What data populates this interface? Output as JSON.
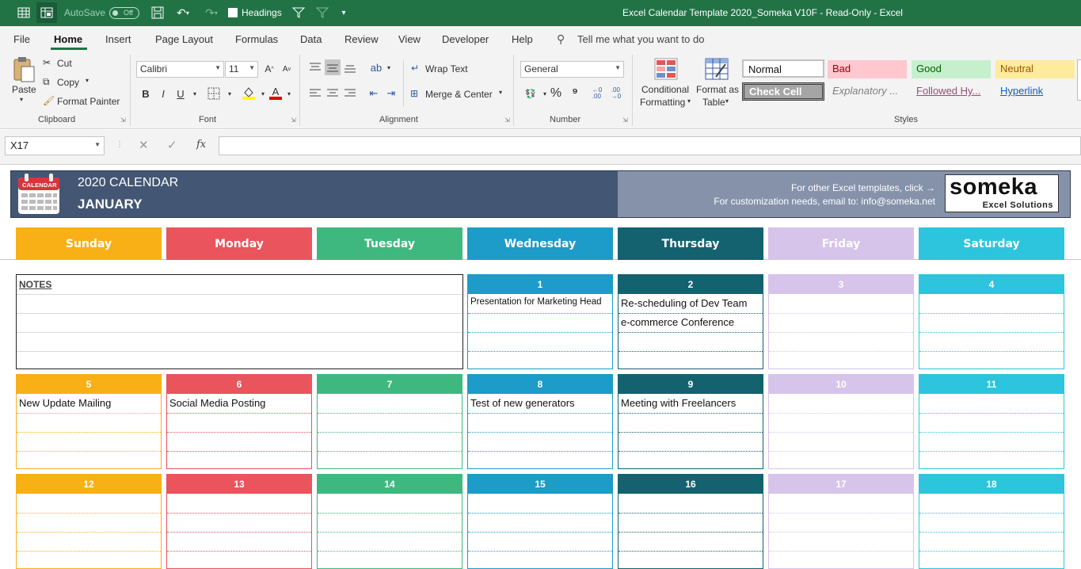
{
  "titlebar": {
    "autosave_label": "AutoSave",
    "autosave_state": "Off",
    "headings_label": "Headings",
    "window_title": "Excel Calendar Template 2020_Someka V10F  -  Read-Only  -  Excel"
  },
  "menu": [
    "File",
    "Home",
    "Insert",
    "Page Layout",
    "Formulas",
    "Data",
    "Review",
    "View",
    "Developer",
    "Help"
  ],
  "tell_me": "Tell me what you want to do",
  "ribbon": {
    "clipboard": {
      "paste": "Paste",
      "cut": "Cut",
      "copy": "Copy",
      "format_painter": "Format Painter",
      "group": "Clipboard"
    },
    "font": {
      "name": "Calibri",
      "size": "11",
      "group": "Font"
    },
    "alignment": {
      "wrap": "Wrap Text",
      "merge": "Merge & Center",
      "group": "Alignment"
    },
    "number": {
      "format": "General",
      "group": "Number"
    },
    "styles": {
      "conditional_1": "Conditional",
      "conditional_2": "Formatting",
      "format_table_1": "Format as",
      "format_table_2": "Table",
      "normal": "Normal",
      "bad": "Bad",
      "good": "Good",
      "neutral": "Neutral",
      "check_cell": "Check Cell",
      "explanatory": "Explanatory ...",
      "followed": "Followed Hy...",
      "hyperlink": "Hyperlink",
      "group": "Styles"
    }
  },
  "formula_bar": {
    "name_box": "X17",
    "fx": "fx",
    "value": ""
  },
  "banner": {
    "icon_label": "CALENDAR",
    "year_title": "2020 CALENDAR",
    "month": "JANUARY",
    "templates_text": "For other Excel templates, click →",
    "custom_text": "For customization needs, email to: info@someka.net",
    "logo": "someka",
    "logo_sub": "Excel Solutions"
  },
  "colors": {
    "sunday": "#f8b016",
    "monday": "#e9545d",
    "tuesday": "#3fb87f",
    "wednesday": "#1d9bc9",
    "thursday": "#14626f",
    "friday": "#d6c4ea",
    "saturday": "#2cc5dd"
  },
  "days": [
    "Sunday",
    "Monday",
    "Tuesday",
    "Wednesday",
    "Thursday",
    "Friday",
    "Saturday"
  ],
  "notes_label": "NOTES",
  "weeks": [
    [
      null,
      null,
      null,
      {
        "day": "1",
        "events": [
          "Presentation for Marketing Head"
        ]
      },
      {
        "day": "2",
        "events": [
          "Re-scheduling of Dev Team",
          "e-commerce Conference"
        ]
      },
      {
        "day": "3",
        "events": []
      },
      {
        "day": "4",
        "events": []
      }
    ],
    [
      {
        "day": "5",
        "events": [
          "New Update Mailing"
        ]
      },
      {
        "day": "6",
        "events": [
          "Social Media Posting"
        ]
      },
      {
        "day": "7",
        "events": []
      },
      {
        "day": "8",
        "events": [
          "Test of new generators"
        ]
      },
      {
        "day": "9",
        "events": [
          "Meeting with Freelancers"
        ]
      },
      {
        "day": "10",
        "events": []
      },
      {
        "day": "11",
        "events": []
      }
    ],
    [
      {
        "day": "12",
        "events": []
      },
      {
        "day": "13",
        "events": []
      },
      {
        "day": "14",
        "events": []
      },
      {
        "day": "15",
        "events": []
      },
      {
        "day": "16",
        "events": []
      },
      {
        "day": "17",
        "events": []
      },
      {
        "day": "18",
        "events": []
      }
    ]
  ]
}
